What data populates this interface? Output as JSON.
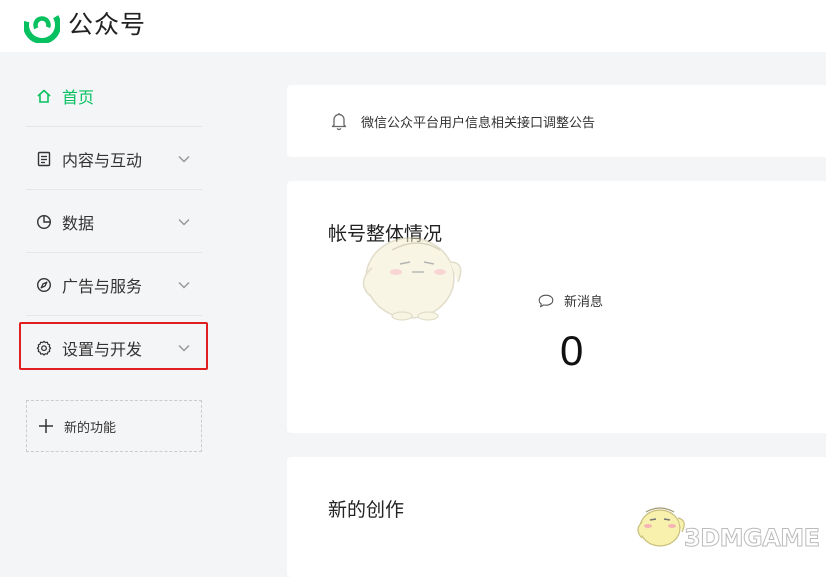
{
  "header": {
    "brand": "公众号",
    "logo_icon": "wechat-official-account-logo",
    "accent": "#07c160"
  },
  "sidebar": {
    "items": [
      {
        "label": "首页",
        "icon": "home-icon",
        "active": true,
        "has_chevron": false
      },
      {
        "label": "内容与互动",
        "icon": "document-icon",
        "active": false,
        "has_chevron": true
      },
      {
        "label": "数据",
        "icon": "pie-chart-icon",
        "active": false,
        "has_chevron": true
      },
      {
        "label": "广告与服务",
        "icon": "compass-icon",
        "active": false,
        "has_chevron": true
      },
      {
        "label": "设置与开发",
        "icon": "gear-icon",
        "active": false,
        "has_chevron": true,
        "highlighted": true
      }
    ],
    "new_feature": {
      "label": "新的功能",
      "icon": "plus-icon"
    },
    "highlight_color": "#e02020"
  },
  "main": {
    "notice": {
      "icon": "bell-icon",
      "text": "微信公众平台用户信息相关接口调整公告"
    },
    "overview": {
      "title": "帐号整体情况",
      "new_messages_label": "新消息",
      "new_messages_icon": "chat-bubble-icon",
      "new_messages_count": "0"
    },
    "creation": {
      "title": "新的创作"
    }
  },
  "watermark": {
    "text": "3DMGAME"
  }
}
